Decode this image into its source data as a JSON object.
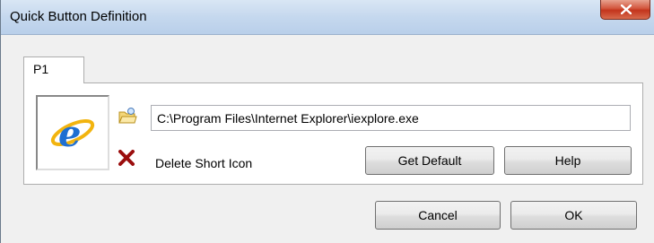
{
  "window": {
    "title": "Quick Button Definition",
    "close_glyph": "X"
  },
  "tabs": [
    {
      "label": "P1"
    }
  ],
  "panel": {
    "program_icon": "internet-explorer-icon",
    "browse_icon": "browse-folder-icon",
    "path_value": "C:\\Program Files\\Internet Explorer\\iexplore.exe",
    "delete_icon": "red-x-icon",
    "delete_label": "Delete Short Icon",
    "get_default_label": "Get Default",
    "help_label": "Help"
  },
  "footer": {
    "cancel_label": "Cancel",
    "ok_label": "OK"
  },
  "colors": {
    "delete_red": "#9b0e0e",
    "ie_blue": "#1f6fd1",
    "ie_gold": "#f2b40f"
  }
}
